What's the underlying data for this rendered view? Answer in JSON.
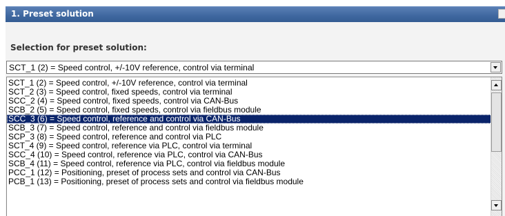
{
  "header": {
    "title": "1. Preset solution"
  },
  "selection": {
    "label": "Selection for preset solution:",
    "combo_value": "SCT_1 (2) = Speed control, +/-10V reference, control via terminal"
  },
  "list": {
    "items": [
      "SCT_1 (2) = Speed control, +/-10V reference, control via terminal",
      "SCT_2 (3) = Speed control, fixed speeds, control via terminal",
      "SCC_2 (4) = Speed control, fixed speeds, control via CAN-Bus",
      "SCB_2 (5) = Speed control, fixed speeds, control via fieldbus module",
      "SCC_3 (6) = Speed control, reference and control via CAN-Bus",
      "SCB_3 (7) = Speed control, reference and control via fieldbus module",
      "SCP_3 (8) = Speed control, reference and control via PLC",
      "SCT_4 (9) = Speed control, reference via PLC, control via terminal",
      "SCC_4 (10) = Speed control, reference via PLC, control via CAN-Bus",
      "SCB_4 (11) = Speed control, reference via PLC, control via fieldbus module",
      "PCC_1 (12) = Positioning, preset of process sets and control via CAN-Bus",
      "PCB_1 (13) = Positioning, preset of process sets and control via fieldbus module"
    ],
    "selected_index": 4
  },
  "colors": {
    "header_bg": "#3e679f",
    "selection_bg": "#0a246a",
    "panel_bg": "#f3f3f3"
  },
  "icons": {
    "combo_dropdown": "chevron-down-icon",
    "scroll_up": "arrow-up-icon",
    "scroll_down": "arrow-down-icon"
  }
}
